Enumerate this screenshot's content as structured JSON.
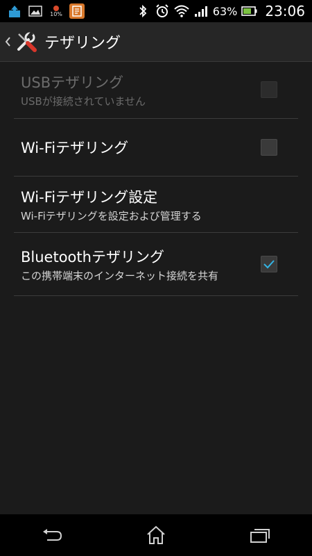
{
  "status_bar": {
    "icons_left": [
      "upload-icon",
      "image-icon",
      "cpu-icon",
      "app-notification-icon"
    ],
    "cpu_label": "10%",
    "icons_right": [
      "bluetooth-icon",
      "alarm-icon",
      "wifi-icon",
      "signal-icon",
      "battery-icon"
    ],
    "battery_percent": "63%",
    "time": "23:06"
  },
  "action_bar": {
    "title": "テザリング",
    "icon": "tools-icon"
  },
  "items": [
    {
      "title": "USBテザリング",
      "summary": "USBが接続されていません",
      "enabled": false,
      "checked": false
    },
    {
      "title": "Wi-Fiテザリング",
      "summary": "",
      "enabled": true,
      "checked": false
    },
    {
      "title": "Wi-Fiテザリング設定",
      "summary": "Wi-Fiテザリングを設定および管理する",
      "enabled": true
    },
    {
      "title": "Bluetoothテザリング",
      "summary": "この携帯端末のインターネット接続を共有",
      "enabled": true,
      "checked": true
    }
  ],
  "colors": {
    "background": "#1b1b1b",
    "action_bar": "#262626",
    "accent_check": "#33b5e5",
    "divider": "#3c3c3c"
  }
}
